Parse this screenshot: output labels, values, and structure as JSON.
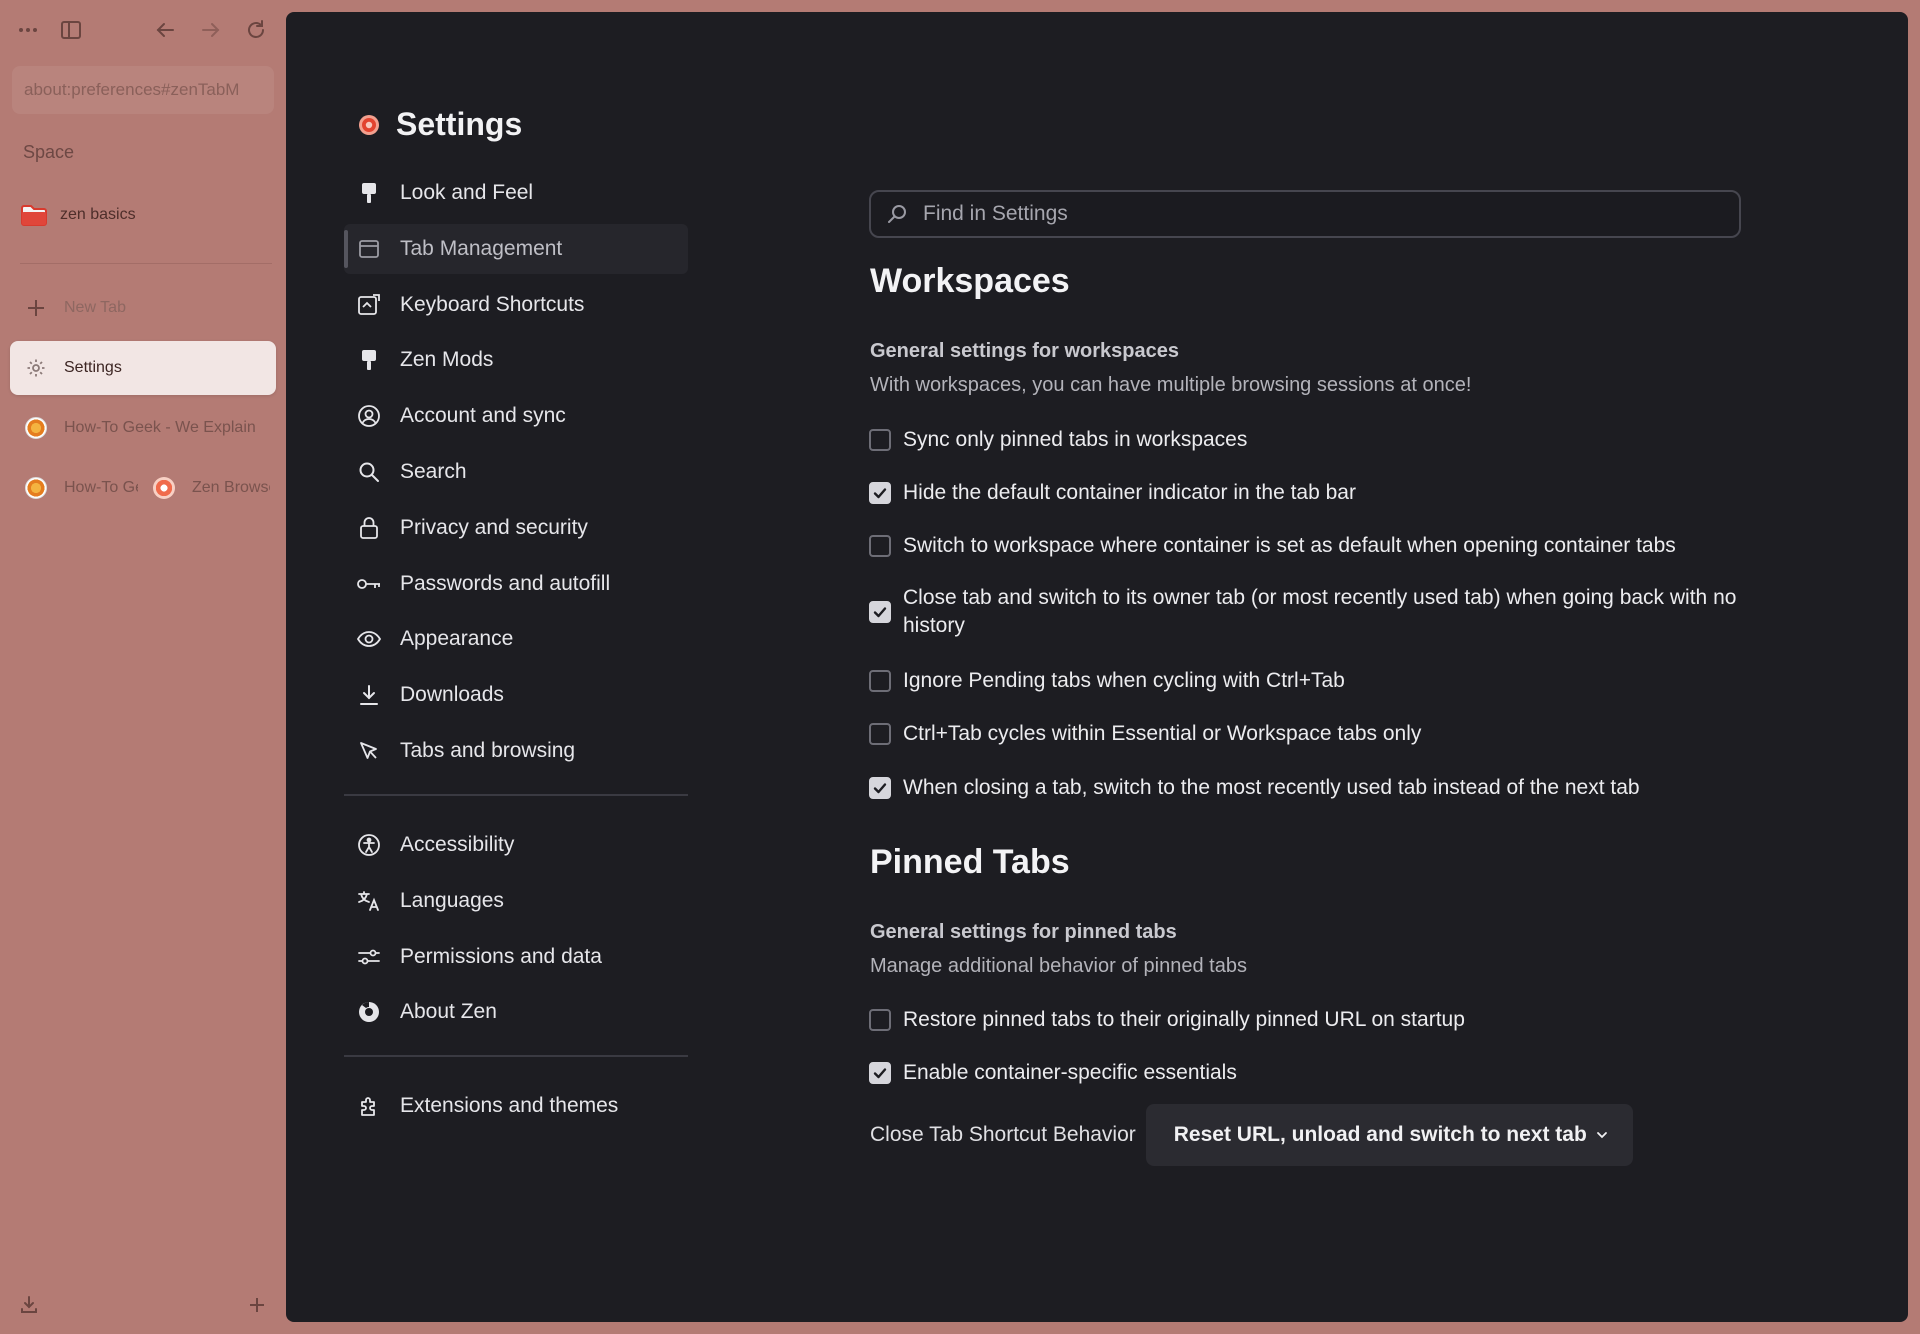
{
  "browser": {
    "url": "about:preferences#zenTabM",
    "space_label": "Space",
    "folder_label": "zen basics",
    "new_tab_label": "New Tab",
    "tabs": [
      {
        "label": "Settings",
        "active": true,
        "icon": "gear-icon"
      },
      {
        "label": "How-To Geek - We Explain",
        "icon": "howtogeek-favicon"
      }
    ],
    "split_tab": {
      "left_label": "How-To Geek",
      "right_label": "Zen Browser"
    }
  },
  "settings": {
    "title": "Settings",
    "categories_main": [
      {
        "label": "Look and Feel",
        "icon": "paintbrush-icon"
      },
      {
        "label": "Tab Management",
        "icon": "tab-icon",
        "selected": true
      },
      {
        "label": "Keyboard Shortcuts",
        "icon": "keyboard-shortcuts-icon"
      },
      {
        "label": "Zen Mods",
        "icon": "paintbrush-icon"
      },
      {
        "label": "Account and sync",
        "icon": "account-icon"
      },
      {
        "label": "Search",
        "icon": "search-icon"
      },
      {
        "label": "Privacy and security",
        "icon": "lock-icon"
      },
      {
        "label": "Passwords and autofill",
        "icon": "key-icon"
      },
      {
        "label": "Appearance",
        "icon": "eye-icon"
      },
      {
        "label": "Downloads",
        "icon": "download-icon"
      },
      {
        "label": "Tabs and browsing",
        "icon": "cursor-icon"
      }
    ],
    "categories_support": [
      {
        "label": "Accessibility",
        "icon": "accessibility-icon"
      },
      {
        "label": "Languages",
        "icon": "translate-icon"
      },
      {
        "label": "Permissions and data",
        "icon": "sliders-icon"
      },
      {
        "label": "About Zen",
        "icon": "zen-logo-icon"
      }
    ],
    "categories_extra": [
      {
        "label": "Extensions and themes",
        "icon": "puzzle-icon"
      }
    ],
    "search_placeholder": "Find in Settings",
    "workspaces": {
      "title": "Workspaces",
      "group_title": "General settings for workspaces",
      "group_desc": "With workspaces, you can have multiple browsing sessions at once!",
      "options": [
        {
          "label": "Sync only pinned tabs in workspaces",
          "checked": false
        },
        {
          "label": "Hide the default container indicator in the tab bar",
          "checked": true
        },
        {
          "label": "Switch to workspace where container is set as default when opening container tabs",
          "checked": false
        },
        {
          "label": "Close tab and switch to its owner tab (or most recently used tab) when going back with no history",
          "checked": true
        },
        {
          "label": "Ignore Pending tabs when cycling with Ctrl+Tab",
          "checked": false
        },
        {
          "label": "Ctrl+Tab cycles within Essential or Workspace tabs only",
          "checked": false
        },
        {
          "label": "When closing a tab, switch to the most recently used tab instead of the next tab",
          "checked": true
        }
      ]
    },
    "pinned_tabs": {
      "title": "Pinned Tabs",
      "group_title": "General settings for pinned tabs",
      "group_desc": "Manage additional behavior of pinned tabs",
      "options": [
        {
          "label": "Restore pinned tabs to their originally pinned URL on startup",
          "checked": false
        },
        {
          "label": "Enable container-specific essentials",
          "checked": true
        }
      ],
      "shortcut_label": "Close Tab Shortcut Behavior",
      "shortcut_value": "Reset URL, unload and switch to next tab"
    }
  }
}
